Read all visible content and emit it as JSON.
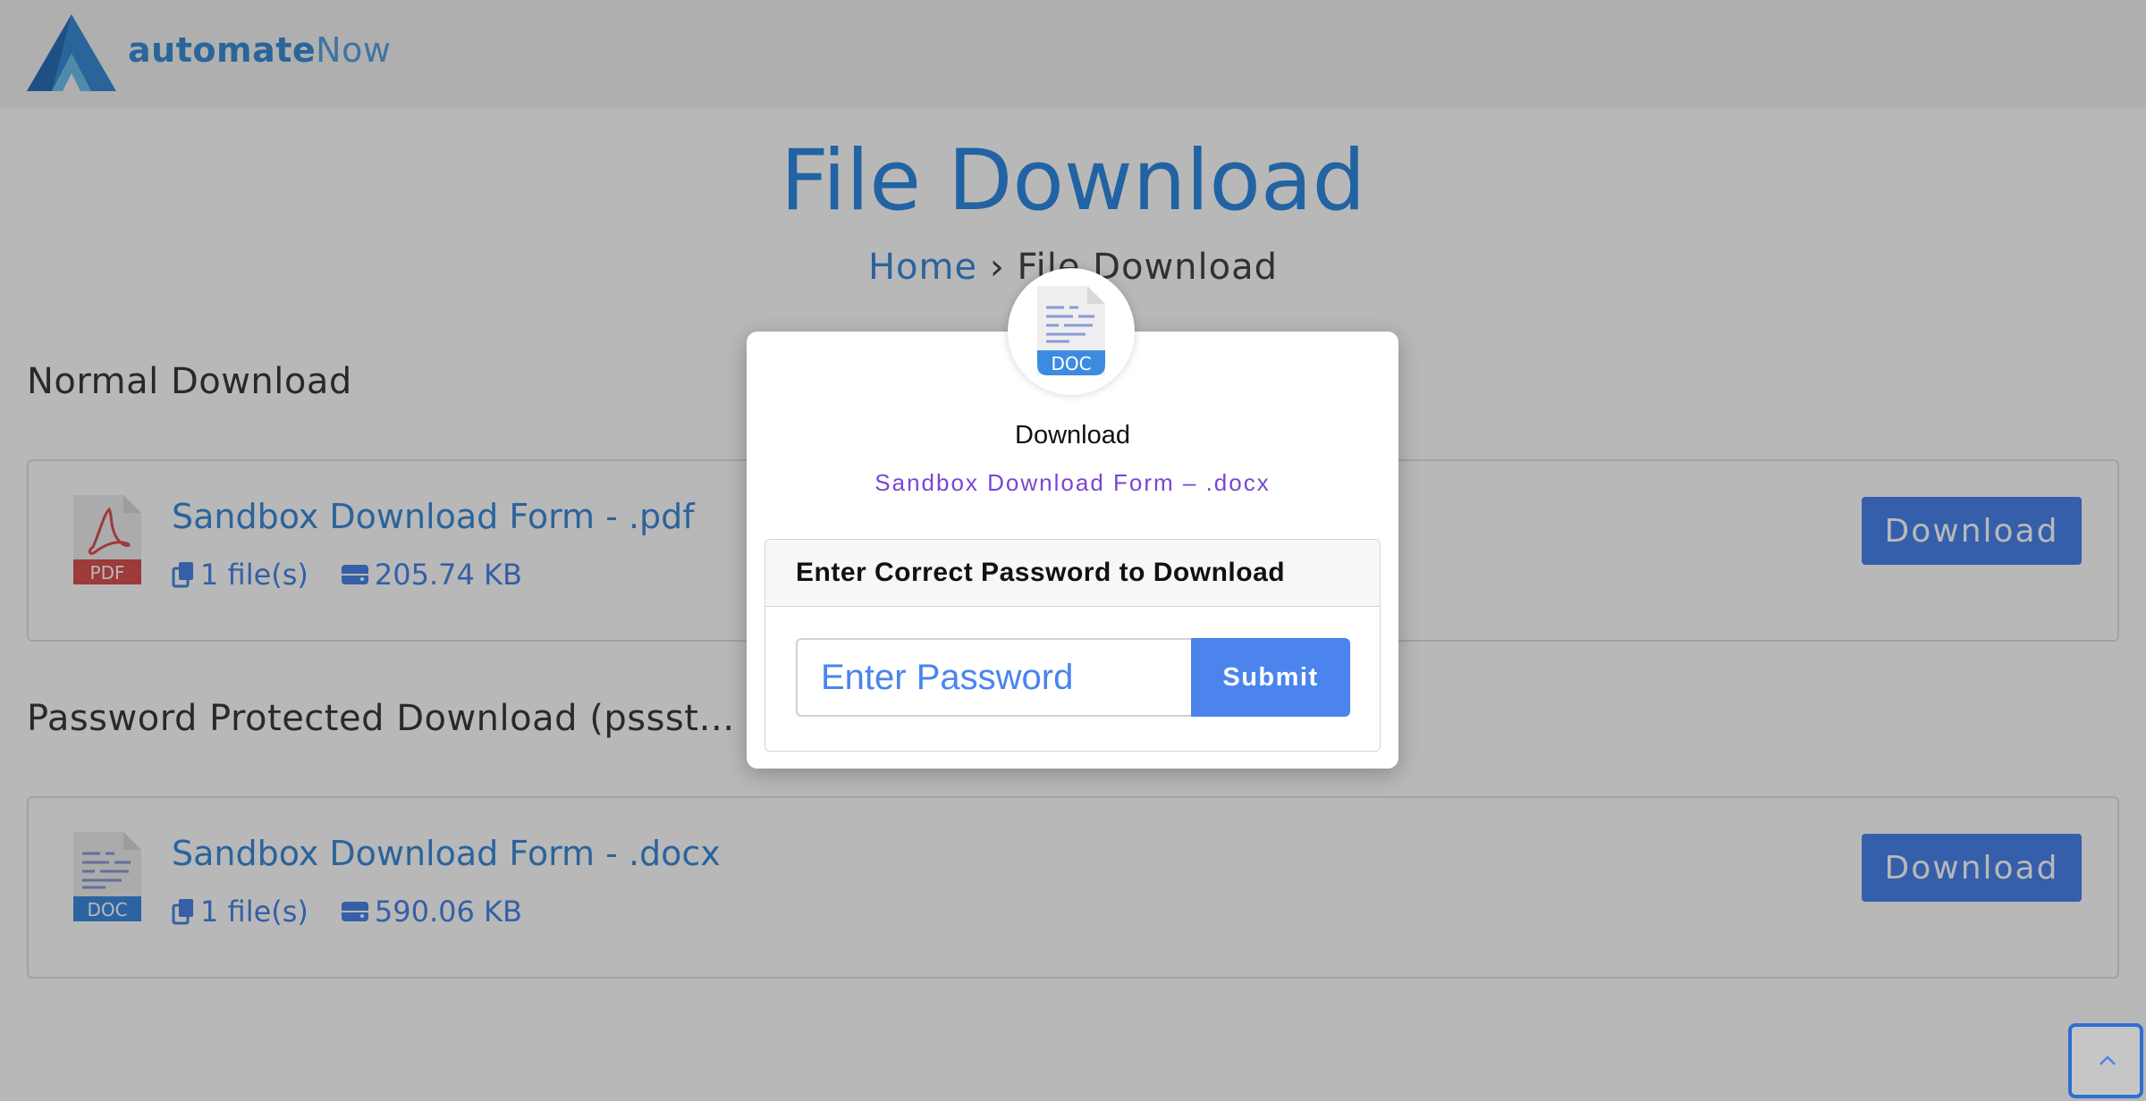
{
  "header": {
    "logo_text_bold": "automate",
    "logo_text_light": "Now"
  },
  "page": {
    "title": "File Download",
    "breadcrumb_home": "Home",
    "breadcrumb_sep": "›",
    "breadcrumb_current": "File Download"
  },
  "sections": [
    {
      "heading": "Normal Download",
      "file": {
        "icon_label": "PDF",
        "title": "Sandbox Download Form - .pdf",
        "files_count": "1 file(s)",
        "size": "205.74 KB",
        "button_label": "Download"
      }
    },
    {
      "heading": "Password Protected Download (pssst… “automateNow”)",
      "file": {
        "icon_label": "DOC",
        "title": "Sandbox Download Form - .docx",
        "files_count": "1 file(s)",
        "size": "590.06 KB",
        "button_label": "Download"
      }
    }
  ],
  "modal": {
    "icon_label": "DOC",
    "title": "Download",
    "subtitle": "Sandbox Download Form – .docx",
    "panel_heading": "Enter Correct Password to Download",
    "input_placeholder": "Enter Password",
    "input_value": "",
    "submit_label": "Submit"
  },
  "colors": {
    "accent": "#4a84ec",
    "title_blue": "#2f8ae2",
    "subtitle_purple": "#7a45d4",
    "pdf_red": "#d9534f",
    "doc_blue": "#3d8be0"
  }
}
